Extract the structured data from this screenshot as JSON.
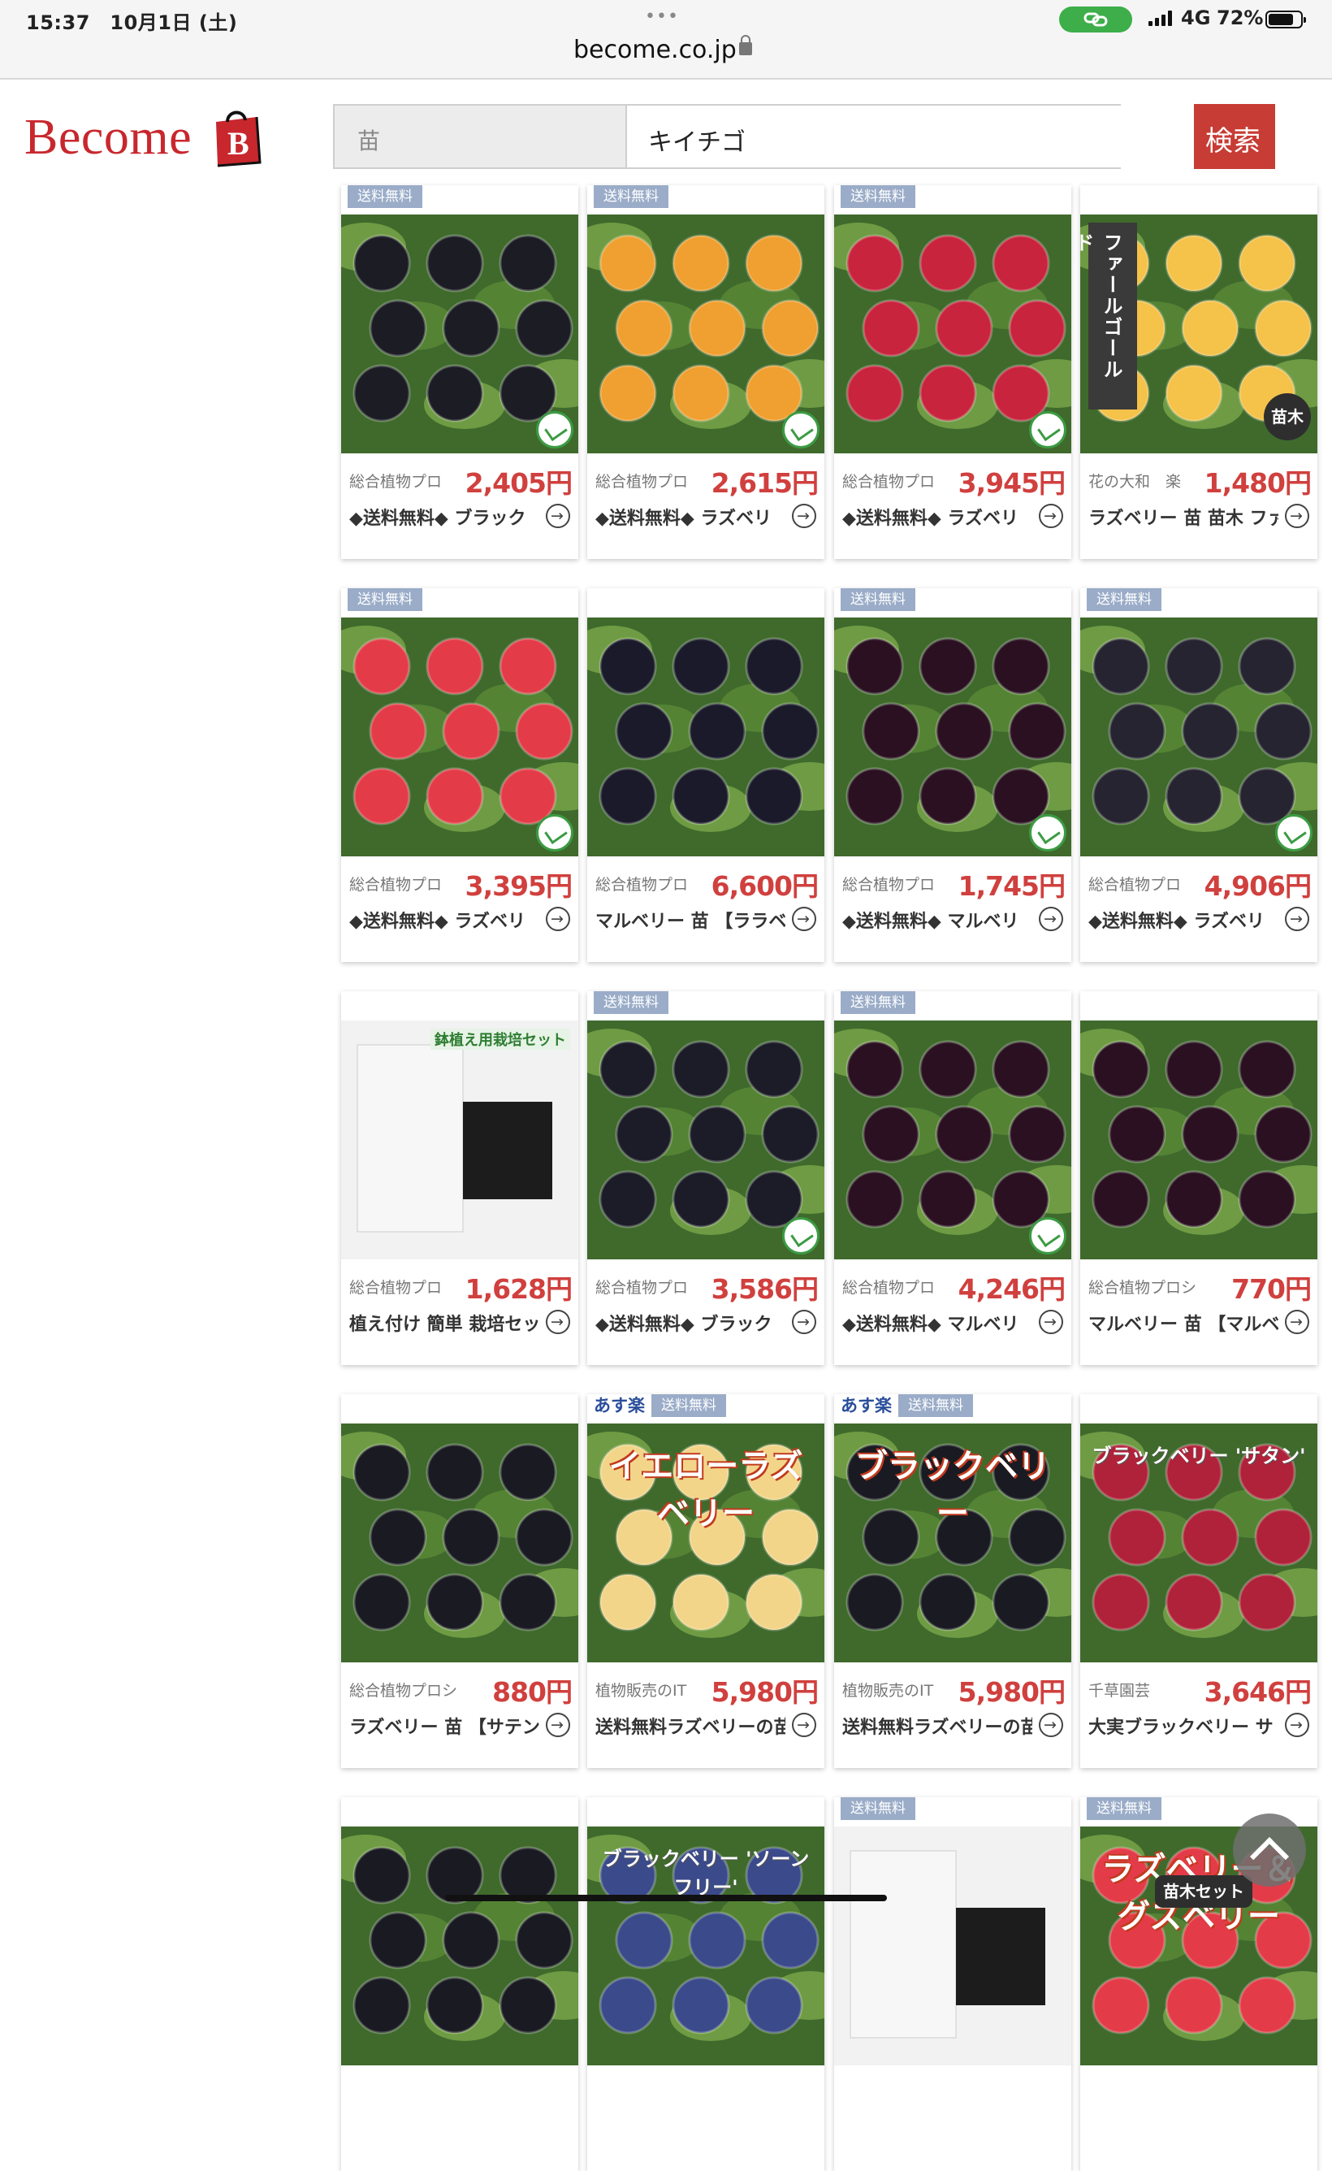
{
  "status": {
    "time": "15:37",
    "date": "10月1日 (土)",
    "network": "4G",
    "battery": "72%"
  },
  "browser": {
    "url": "become.co.jp"
  },
  "header": {
    "logo_text": "Become",
    "logo_bag_letter": "B"
  },
  "search": {
    "category": "苗",
    "query": "キイチゴ",
    "button": "検索"
  },
  "colors": {
    "accent": "#c73c34",
    "price": "#d0403e",
    "tag": "#9aacc8"
  },
  "products": [
    {
      "shop": "総合植物プロ",
      "price": "2,405円",
      "title": "◆送料無料◆ ブラック",
      "tags": [
        "送料無料"
      ],
      "fruit": "#1c1c24"
    },
    {
      "shop": "総合植物プロ",
      "price": "2,615円",
      "title": "◆送料無料◆ ラズベリ",
      "tags": [
        "送料無料"
      ],
      "fruit": "#f0a030"
    },
    {
      "shop": "総合植物プロ",
      "price": "3,945円",
      "title": "◆送料無料◆ ラズベリ",
      "tags": [
        "送料無料"
      ],
      "fruit": "#c8243e"
    },
    {
      "shop": "花の大和　楽",
      "price": "1,480円",
      "title": "ラズベリー 苗 苗木 ファ",
      "tags": [],
      "fruit": "#f5c24a",
      "vertical": "ファールゴールド",
      "naegi": "苗木"
    },
    {
      "shop": "総合植物プロ",
      "price": "3,395円",
      "title": "◆送料無料◆ ラズベリ",
      "tags": [
        "送料無料"
      ],
      "fruit": "#e33c48"
    },
    {
      "shop": "総合植物プロ",
      "price": "6,600円",
      "title": "マルベリー 苗 【ララベ",
      "tags": [],
      "fruit": "#1a1a2a"
    },
    {
      "shop": "総合植物プロ",
      "price": "1,745円",
      "title": "◆送料無料◆ マルベリ",
      "tags": [
        "送料無料"
      ],
      "fruit": "#2a1020"
    },
    {
      "shop": "総合植物プロ",
      "price": "4,906円",
      "title": "◆送料無料◆ ラズベリ",
      "tags": [
        "送料無料"
      ],
      "fruit": "#262430"
    },
    {
      "shop": "総合植物プロ",
      "price": "1,628円",
      "title": "植え付け 簡単 栽培セッ",
      "tags": [],
      "fruit": "#efefef",
      "caption2": "鉢植え用栽培セット"
    },
    {
      "shop": "総合植物プロ",
      "price": "3,586円",
      "title": "◆送料無料◆ ブラック",
      "tags": [
        "送料無料"
      ],
      "fruit": "#1c1c28"
    },
    {
      "shop": "総合植物プロ",
      "price": "4,246円",
      "title": "◆送料無料◆ マルベリ",
      "tags": [
        "送料無料"
      ],
      "fruit": "#2a1020"
    },
    {
      "shop": "総合植物プロシ",
      "price": "770円",
      "title": "マルベリー 苗 【マルベ",
      "tags": [],
      "fruit": "#2a1020"
    },
    {
      "shop": "総合植物プロシ",
      "price": "880円",
      "title": "ラズベリー 苗 【サテン",
      "tags": [],
      "fruit": "#1a1a22"
    },
    {
      "shop": "植物販売のIT",
      "price": "5,980円",
      "title": "送料無料ラズベリーの苗",
      "tags": [
        "あす楽",
        "送料無料"
      ],
      "fruit": "#f3d58a",
      "caption": "イエローラズベリー"
    },
    {
      "shop": "植物販売のIT",
      "price": "5,980円",
      "title": "送料無料ラズベリーの苗",
      "tags": [
        "あす楽",
        "送料無料"
      ],
      "fruit": "#1a1a22",
      "caption": "ブラックベリー"
    },
    {
      "shop": "千草園芸",
      "price": "3,646円",
      "title": "大実ブラックベリー サ",
      "tags": [],
      "fruit": "#b0223a",
      "caption3": "ブラックベリー 'サタン'"
    },
    {
      "shop": "",
      "price": "",
      "title": "",
      "tags": [],
      "fruit": "#1a1a22"
    },
    {
      "shop": "",
      "price": "",
      "title": "",
      "tags": [],
      "fruit": "#3b4a8a",
      "caption3": "ブラックベリー 'ソーンフリー'"
    },
    {
      "shop": "",
      "price": "",
      "title": "",
      "tags": [
        "送料無料"
      ],
      "fruit": "#e8e8e8"
    },
    {
      "shop": "",
      "price": "",
      "title": "",
      "tags": [
        "送料無料"
      ],
      "fruit": "#e33c48",
      "caption": "ラズベリー＆グズベリー",
      "naegi": "苗木セット"
    }
  ]
}
